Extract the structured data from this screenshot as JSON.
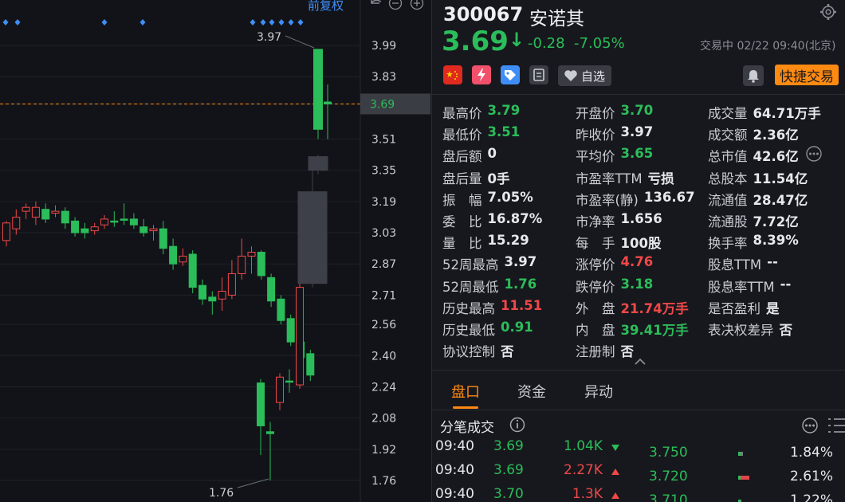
{
  "chart": {
    "top_label": "前复权",
    "toolbar_icons": [
      "undo-icon",
      "zoom-out-icon",
      "zoom-in-icon"
    ],
    "price_axis": [
      "3.99",
      "3.83",
      "3.69",
      "3.51",
      "3.35",
      "3.19",
      "3.03",
      "2.87",
      "2.71",
      "2.56",
      "2.40",
      "2.24",
      "2.08",
      "1.92",
      "1.76"
    ],
    "current_price_tag": "3.69",
    "high_marker": "3.97",
    "low_marker": "1.76",
    "colors": {
      "up": "#f04848",
      "down": "#2bbd5a",
      "current": "#ff8a12",
      "flat": "#3e4049",
      "marker": "#3f8ef7"
    }
  },
  "chart_data": {
    "type": "candlestick",
    "ylim": [
      1.7,
      4.05
    ],
    "candles": [
      [
        2.99,
        3.08,
        3.09,
        2.96
      ],
      [
        3.05,
        3.11,
        3.15,
        3.02
      ],
      [
        3.14,
        3.16,
        3.18,
        3.1
      ],
      [
        3.11,
        3.16,
        3.19,
        3.07
      ],
      [
        3.15,
        3.1,
        3.18,
        3.08
      ],
      [
        3.13,
        3.14,
        3.17,
        3.11
      ],
      [
        3.14,
        3.08,
        3.16,
        3.05
      ],
      [
        3.09,
        3.03,
        3.11,
        3.01
      ],
      [
        3.05,
        3.03,
        3.08,
        3.0
      ],
      [
        3.04,
        3.06,
        3.08,
        3.02
      ],
      [
        3.07,
        3.1,
        3.12,
        3.05
      ],
      [
        3.09,
        3.09,
        3.14,
        3.06
      ],
      [
        3.1,
        3.1,
        3.18,
        3.07
      ],
      [
        3.1,
        3.07,
        3.13,
        3.05
      ],
      [
        3.06,
        3.03,
        3.1,
        3.01
      ],
      [
        3.04,
        3.05,
        3.07,
        2.99
      ],
      [
        3.05,
        2.95,
        3.09,
        2.92
      ],
      [
        2.96,
        2.87,
        3.0,
        2.84
      ],
      [
        2.88,
        2.91,
        2.95,
        2.86
      ],
      [
        2.92,
        2.75,
        2.94,
        2.72
      ],
      [
        2.76,
        2.69,
        2.79,
        2.66
      ],
      [
        2.7,
        2.68,
        2.73,
        2.61
      ],
      [
        2.69,
        2.73,
        2.8,
        2.63
      ],
      [
        2.71,
        2.82,
        2.89,
        2.69
      ],
      [
        2.82,
        2.91,
        3.0,
        2.79
      ],
      [
        2.91,
        2.93,
        2.96,
        2.82
      ],
      [
        2.93,
        2.81,
        2.94,
        2.79
      ],
      [
        2.8,
        2.68,
        2.82,
        2.65
      ],
      [
        2.69,
        2.58,
        2.71,
        2.56
      ],
      [
        2.59,
        2.47,
        2.61,
        2.45
      ],
      [
        2.47,
        2.39,
        2.49,
        2.36
      ],
      [
        2.41,
        2.3,
        2.43,
        2.27
      ],
      [
        2.26,
        2.04,
        2.28,
        1.89
      ],
      [
        2.01,
        2.0,
        2.06,
        1.76
      ],
      [
        2.16,
        2.29,
        2.31,
        2.12
      ],
      [
        2.27,
        2.27,
        2.33,
        2.21
      ],
      [
        2.25,
        2.75,
        2.77,
        2.23
      ],
      [
        2.77,
        3.24,
        3.39,
        2.75
      ],
      [
        3.42,
        3.35,
        3.43,
        3.33
      ],
      [
        3.97,
        3.56,
        3.97,
        3.51
      ],
      [
        3.7,
        3.69,
        3.79,
        3.51
      ]
    ]
  },
  "stock": {
    "code": "300067",
    "name": "安诺其",
    "price": "3.69",
    "arrow": "↓",
    "change": "-0.28",
    "change_pct": "-7.05%",
    "status": "交易中 02/22 09:40(北京)",
    "watch_label": "自选",
    "quick_trade": "快捷交易",
    "icons": [
      "china-flag-icon",
      "lightning-icon",
      "tag-icon",
      "note-icon",
      "heart-icon",
      "bell-icon",
      "settings-gear-icon",
      "more-icon"
    ]
  },
  "stats": {
    "col1": [
      {
        "label": "最高价",
        "value": "3.79",
        "color": "g"
      },
      {
        "label": "最低价",
        "value": "3.51",
        "color": "g"
      },
      {
        "label": "盘后额",
        "value": "0",
        "color": "w"
      },
      {
        "label": "盘后量",
        "value": "0手",
        "color": "w"
      },
      {
        "label": "振　幅",
        "value": "7.05%",
        "color": "w"
      },
      {
        "label": "委　比",
        "value": "16.87%",
        "color": "w"
      },
      {
        "label": "量　比",
        "value": "15.29",
        "color": "w"
      },
      {
        "label": "52周最高",
        "value": "3.97",
        "color": "w"
      },
      {
        "label": "52周最低",
        "value": "1.76",
        "color": "g"
      },
      {
        "label": "历史最高",
        "value": "11.51",
        "color": "r"
      },
      {
        "label": "历史最低",
        "value": "0.91",
        "color": "g"
      },
      {
        "label": "协议控制",
        "value": "否",
        "color": "w"
      }
    ],
    "col2": [
      {
        "label": "开盘价",
        "value": "3.70",
        "color": "g"
      },
      {
        "label": "昨收价",
        "value": "3.97",
        "color": "w"
      },
      {
        "label": "平均价",
        "value": "3.65",
        "color": "g"
      },
      {
        "label": "市盈率TTM",
        "value": "亏损",
        "color": "w"
      },
      {
        "label": "市盈率(静)",
        "value": "136.67",
        "color": "w"
      },
      {
        "label": "市净率",
        "value": "1.656",
        "color": "w"
      },
      {
        "label": "每　手",
        "value": "100股",
        "color": "w"
      },
      {
        "label": "涨停价",
        "value": "4.76",
        "color": "r"
      },
      {
        "label": "跌停价",
        "value": "3.18",
        "color": "g"
      },
      {
        "label": "外　盘",
        "value": "21.74万手",
        "color": "r"
      },
      {
        "label": "内　盘",
        "value": "39.41万手",
        "color": "g"
      },
      {
        "label": "注册制",
        "value": "否",
        "color": "w"
      }
    ],
    "col3": [
      {
        "label": "成交量",
        "value": "64.71万手",
        "color": "w"
      },
      {
        "label": "成交额",
        "value": "2.36亿",
        "color": "w"
      },
      {
        "label": "总市值",
        "value": "42.6亿",
        "color": "w"
      },
      {
        "label": "总股本",
        "value": "11.54亿",
        "color": "w"
      },
      {
        "label": "流通值",
        "value": "28.47亿",
        "color": "w"
      },
      {
        "label": "流通股",
        "value": "7.72亿",
        "color": "w"
      },
      {
        "label": "换手率",
        "value": "8.39%",
        "color": "w"
      },
      {
        "label": "股息TTM",
        "value": "--",
        "color": "w"
      },
      {
        "label": "股息率TTM",
        "value": "--",
        "color": "w"
      },
      {
        "label": "是否盈利",
        "value": "是",
        "color": "w"
      },
      {
        "label": "表决权差异",
        "value": "否",
        "color": "w"
      }
    ]
  },
  "tabs": [
    {
      "label": "盘口",
      "active": true
    },
    {
      "label": "资金",
      "active": false
    },
    {
      "label": "异动",
      "active": false
    }
  ],
  "trades": {
    "title": "分笔成交",
    "rows": [
      {
        "time": "09:40",
        "price": "3.69",
        "volume": "1.04K",
        "dir": "down"
      },
      {
        "time": "09:40",
        "price": "3.69",
        "volume": "2.27K",
        "dir": "up"
      },
      {
        "time": "09:40",
        "price": "3.70",
        "volume": "1.3K",
        "dir": "up"
      }
    ],
    "levels": [
      {
        "price": "3.750",
        "pct": "1.84%",
        "share": 0.35
      },
      {
        "price": "3.720",
        "pct": "2.61%",
        "share": 0.9
      },
      {
        "price": "3.710",
        "pct": "1.22%",
        "share": 0.25
      }
    ]
  }
}
